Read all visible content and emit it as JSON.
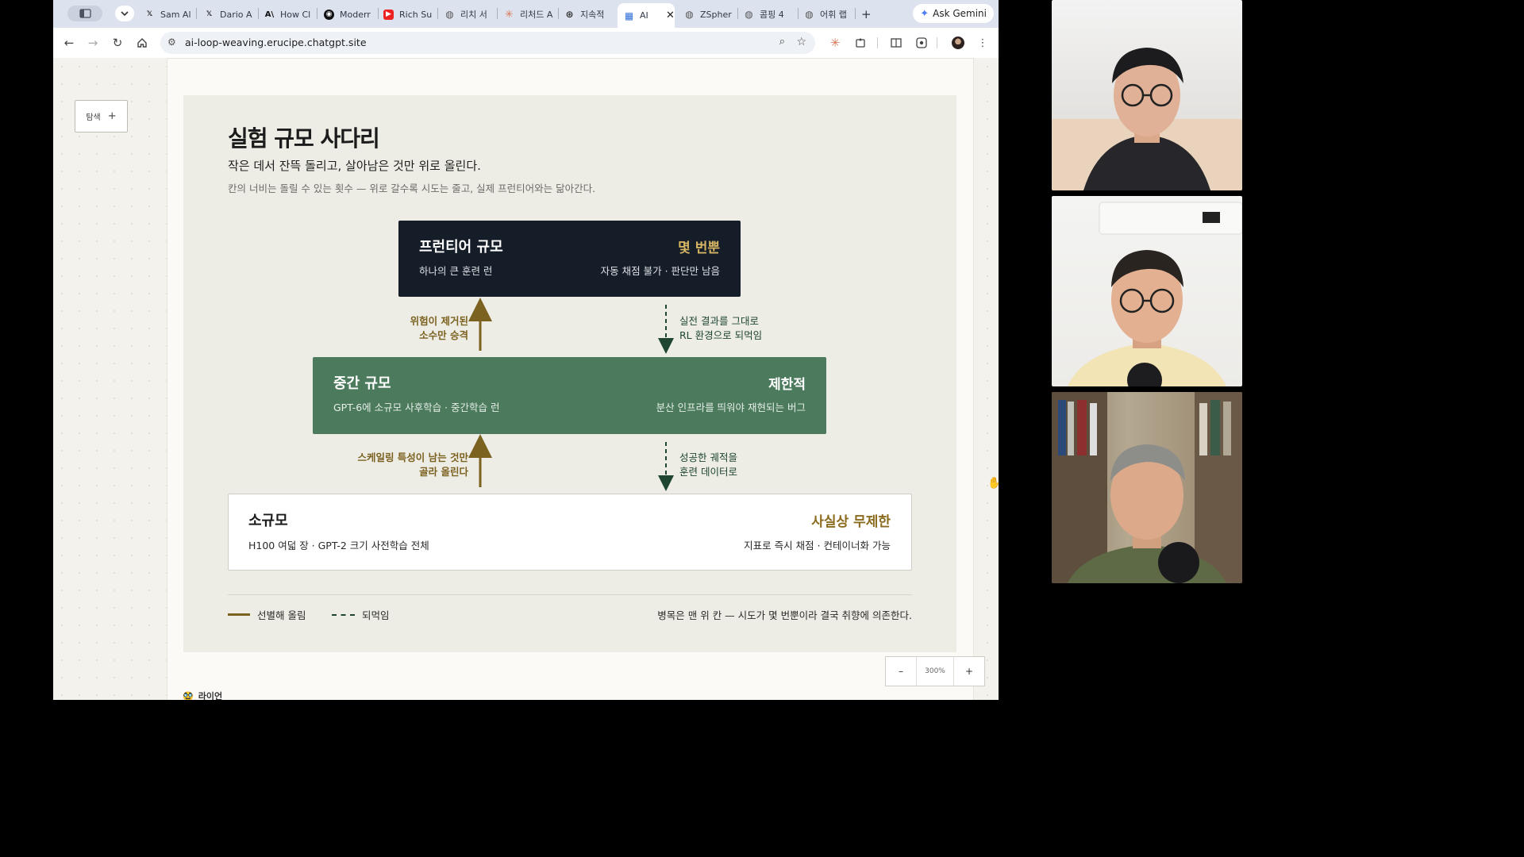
{
  "browser": {
    "tabs": [
      {
        "label": "Sam Al",
        "icon": "x-icon"
      },
      {
        "label": "Dario A",
        "icon": "x-icon"
      },
      {
        "label": "How Cl",
        "icon": "anthropic-icon"
      },
      {
        "label": "Moderr",
        "icon": "medium-icon"
      },
      {
        "label": "Rich Su",
        "icon": "youtube-icon"
      },
      {
        "label": "리치 서",
        "icon": "globe-icon"
      },
      {
        "label": "리처드 A",
        "icon": "claude-icon"
      },
      {
        "label": "지속적",
        "icon": "openai-icon"
      },
      {
        "label": "AI",
        "icon": "app-grid-icon"
      },
      {
        "label": "ZSpher",
        "icon": "globe-icon"
      },
      {
        "label": "콤핑 4",
        "icon": "globe-icon"
      },
      {
        "label": "어휘 랩",
        "icon": "globe-icon"
      }
    ],
    "new_tab": "+",
    "ask_gemini": "Ask Gemini",
    "url": "ai-loop-weaving.erucipe.chatgpt.site"
  },
  "sidebar": {
    "search_label": "탐색",
    "search_plus": "+"
  },
  "ladder": {
    "title": "실험 규모 사다리",
    "subtitle": "작은 데서 잔뜩 돌리고, 살아남은 것만 위로 올린다.",
    "note": "칸의 너비는 돌릴 수 있는 횟수 — 위로 갈수록 시도는 줄고, 실제 프런티어와는 닮아간다.",
    "tiers": {
      "frontier": {
        "title": "프런티어 규모",
        "tag": "몇 번뿐",
        "desc": "하나의 큰 훈련 런",
        "desc_right": "자동 채점 불가 · 판단만 남음"
      },
      "mid": {
        "title": "중간 규모",
        "tag": "제한적",
        "desc": "GPT-6에 소규모 사후학습 · 중간학습 런",
        "desc_right": "분산 인프라를 띄워야 재현되는 버그"
      },
      "small": {
        "title": "소규모",
        "tag": "사실상 무제한",
        "desc": "H100 여덟 장 · GPT-2 크기 사전학습 전체",
        "desc_right": "지표로 즉시 채점 · 컨테이너화 가능"
      }
    },
    "arrows": {
      "up_top": [
        "위험이 제거된",
        "소수만 승격"
      ],
      "down_top": [
        "실전 결과를 그대로",
        "RL 환경으로 되먹임"
      ],
      "up_bottom": [
        "스케일링 특성이 남는 것만",
        "골라 올린다"
      ],
      "down_bottom": [
        "성공한 궤적을",
        "훈련 데이터로"
      ]
    },
    "legend": {
      "promote": "선별해 올림",
      "feedback": "되먹임",
      "note": "병목은 맨 위 칸 — 시도가 몇 번뿐이라 결국 취향에 의존한다."
    },
    "colors": {
      "promote": "#7c6220",
      "feedback": "#1e4630",
      "frontier_bg": "#151d29",
      "mid_bg": "#4b7a5c"
    }
  },
  "zoom": {
    "minus": "–",
    "value": "300%",
    "plus": "+"
  },
  "author": {
    "emoji": "🥸",
    "name": "라이언"
  }
}
